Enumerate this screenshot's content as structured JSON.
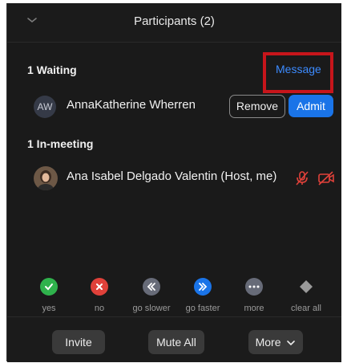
{
  "header": {
    "title": "Participants (2)",
    "collapse_icon": "chevron-down-icon"
  },
  "waiting": {
    "label": "1 Waiting",
    "message_link": "Message",
    "participant": {
      "initials": "AW",
      "name": "AnnaKatherine Wherren",
      "remove_label": "Remove",
      "admit_label": "Admit"
    }
  },
  "in_meeting": {
    "label": "1 In-meeting",
    "participant": {
      "name": "Ana Isabel Delgado Valentin (Host, me)",
      "mic_icon": "muted-mic-icon",
      "camera_icon": "video-off-icon"
    }
  },
  "reactions": [
    {
      "label": "yes",
      "icon": "check-icon",
      "color": "#2fb24c"
    },
    {
      "label": "no",
      "icon": "x-icon",
      "color": "#e0413a"
    },
    {
      "label": "go slower",
      "icon": "rewind-icon",
      "color": "#676b78"
    },
    {
      "label": "go faster",
      "icon": "fast-forward-icon",
      "color": "#1a74e8"
    },
    {
      "label": "more",
      "icon": "ellipsis-icon",
      "color": "#676b78"
    },
    {
      "label": "clear all",
      "icon": "eraser-icon",
      "color": "#8a8a8a"
    }
  ],
  "footer": {
    "invite_label": "Invite",
    "mute_all_label": "Mute All",
    "more_label": "More"
  },
  "colors": {
    "panel_bg": "#1a1a1a",
    "accent": "#1a74e8",
    "highlight_box": "#c7151b",
    "muted_red": "#e0413a"
  }
}
